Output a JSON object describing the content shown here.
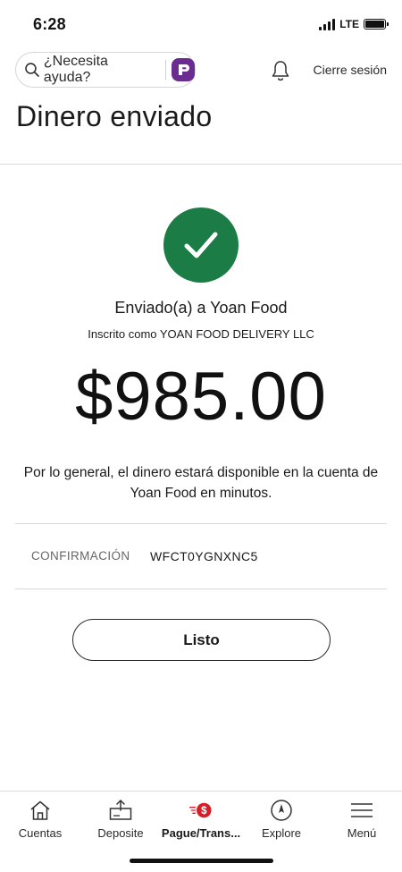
{
  "status_bar": {
    "time": "6:28",
    "network": "LTE"
  },
  "header": {
    "help_placeholder": "¿Necesita ayuda?",
    "logout_label": "Cierre sesión",
    "page_title": "Dinero enviado"
  },
  "confirmation": {
    "sent_to": "Enviado(a) a Yoan Food",
    "enrolled_as": "Inscrito como YOAN FOOD DELIVERY LLC",
    "amount": "$985.00",
    "availability_note": "Por lo general, el dinero estará disponible en la cuenta de Yoan Food en minutos.",
    "confirmation_label": "CONFIRMACIÓN",
    "confirmation_code": "WFCT0YGNXNC5",
    "done_label": "Listo"
  },
  "bottom_nav": {
    "items": [
      {
        "label": "Cuentas",
        "icon": "home-icon"
      },
      {
        "label": "Deposite",
        "icon": "deposit-icon"
      },
      {
        "label": "Pague/Trans...",
        "icon": "pay-transfer-icon",
        "active": true
      },
      {
        "label": "Explore",
        "icon": "compass-icon"
      },
      {
        "label": "Menú",
        "icon": "menu-icon"
      }
    ]
  },
  "colors": {
    "success_green": "#1c7c45",
    "assistant_purple": "#6b2c91",
    "pay_badge_red": "#d71e28"
  }
}
